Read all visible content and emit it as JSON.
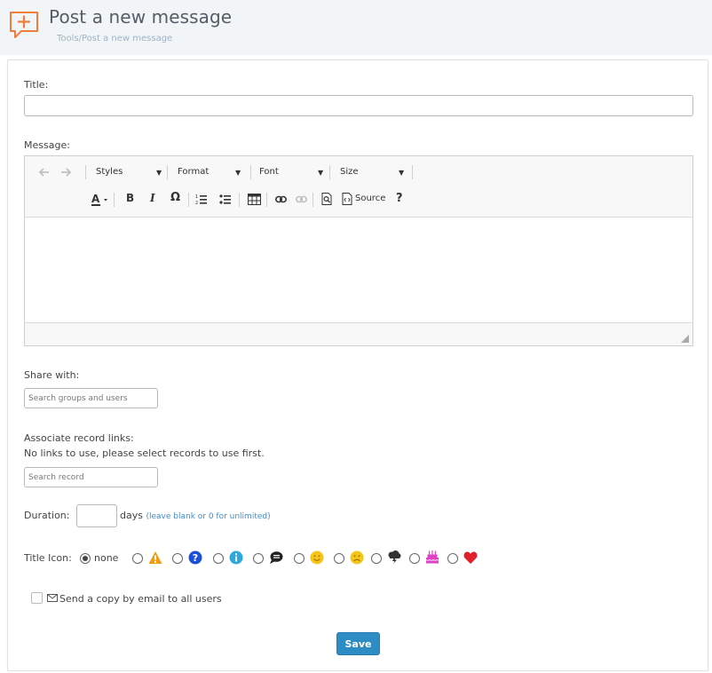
{
  "header": {
    "title": "Post a new message",
    "breadcrumb": "Tools/Post a new message",
    "icon": "message-plus-icon",
    "accent": "#f07d3a"
  },
  "form": {
    "title_label": "Title:",
    "title_value": "",
    "message_label": "Message:",
    "editor": {
      "styles": "Styles",
      "format": "Format",
      "font": "Font",
      "size": "Size",
      "source": "Source",
      "help": "?"
    },
    "share_label": "Share with:",
    "share_placeholder": "Search groups and users",
    "records_label": "Associate record links:",
    "records_note": "No links to use, please select records to use first.",
    "records_placeholder": "Search record",
    "duration_label": "Duration:",
    "duration_value": "",
    "duration_unit": "days",
    "duration_hint": "(leave blank or 0 for unlimited)",
    "title_icon_label": "Title Icon:",
    "title_icon_none": "none",
    "title_icons": [
      "warning-icon",
      "question-icon",
      "info-icon",
      "speech-bubble-icon",
      "smile-icon",
      "sad-face-icon",
      "storm-cloud-icon",
      "cake-icon",
      "heart-icon"
    ],
    "email_copy_label": "Send a copy by email to all users",
    "save_label": "Save"
  },
  "colors": {
    "save_button": "#2e8cc4",
    "hint_link": "#3f8fd0",
    "warning": "#f39c12",
    "question": "#1c4fd8",
    "info": "#2fa8e0",
    "smile": "#f5c518",
    "cake": "#e040c8",
    "heart": "#e0202a"
  }
}
